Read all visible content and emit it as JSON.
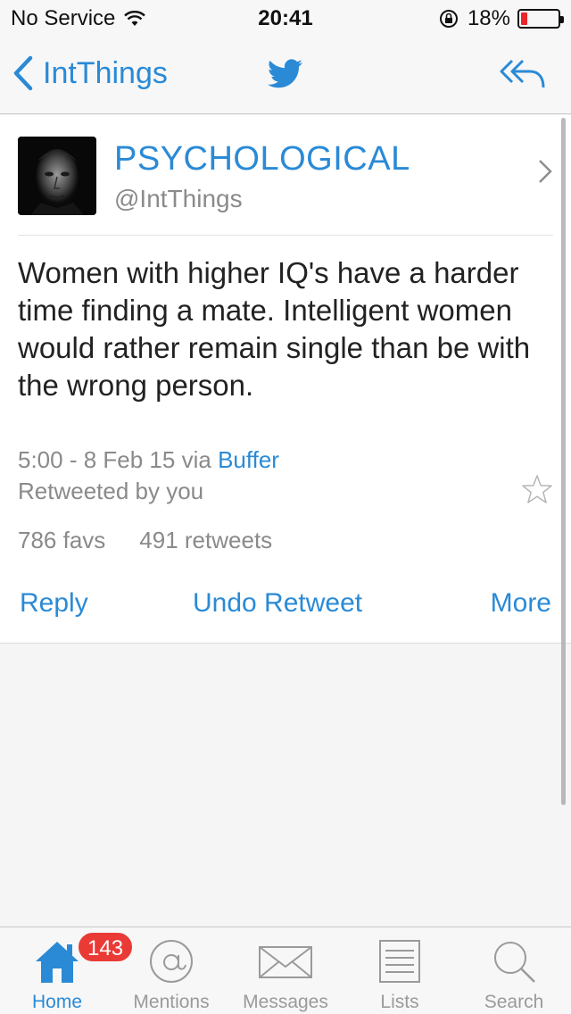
{
  "status_bar": {
    "carrier": "No Service",
    "time": "20:41",
    "battery_percent": "18%",
    "battery_level": 0.18,
    "battery_color": "#e8262b"
  },
  "nav": {
    "back_label": "IntThings",
    "center_icon": "twitter-bird-icon",
    "right_icon": "reply-arrow-icon"
  },
  "tweet": {
    "author_name": "PSYCHOLOGICAL",
    "author_handle": "@IntThings",
    "text": "Women with higher IQ's have a harder time finding a mate. Intelligent women would rather remain single than be with the wrong person.",
    "timestamp": "5:00 - 8 Feb 15",
    "via_prefix": "via",
    "via_source": "Buffer",
    "retweeted_by": "Retweeted by you",
    "favs": "786 favs",
    "retweets": "491 retweets"
  },
  "actions": {
    "reply": "Reply",
    "undo_retweet": "Undo Retweet",
    "more": "More"
  },
  "tabs": [
    {
      "label": "Home",
      "icon": "home-icon",
      "active": true,
      "badge": "143"
    },
    {
      "label": "Mentions",
      "icon": "at-icon",
      "active": false
    },
    {
      "label": "Messages",
      "icon": "envelope-icon",
      "active": false
    },
    {
      "label": "Lists",
      "icon": "list-icon",
      "active": false
    },
    {
      "label": "Search",
      "icon": "search-icon",
      "active": false
    }
  ],
  "colors": {
    "accent": "#2a8ad6",
    "badge": "#ea3a35",
    "muted": "#8a8a8a"
  }
}
